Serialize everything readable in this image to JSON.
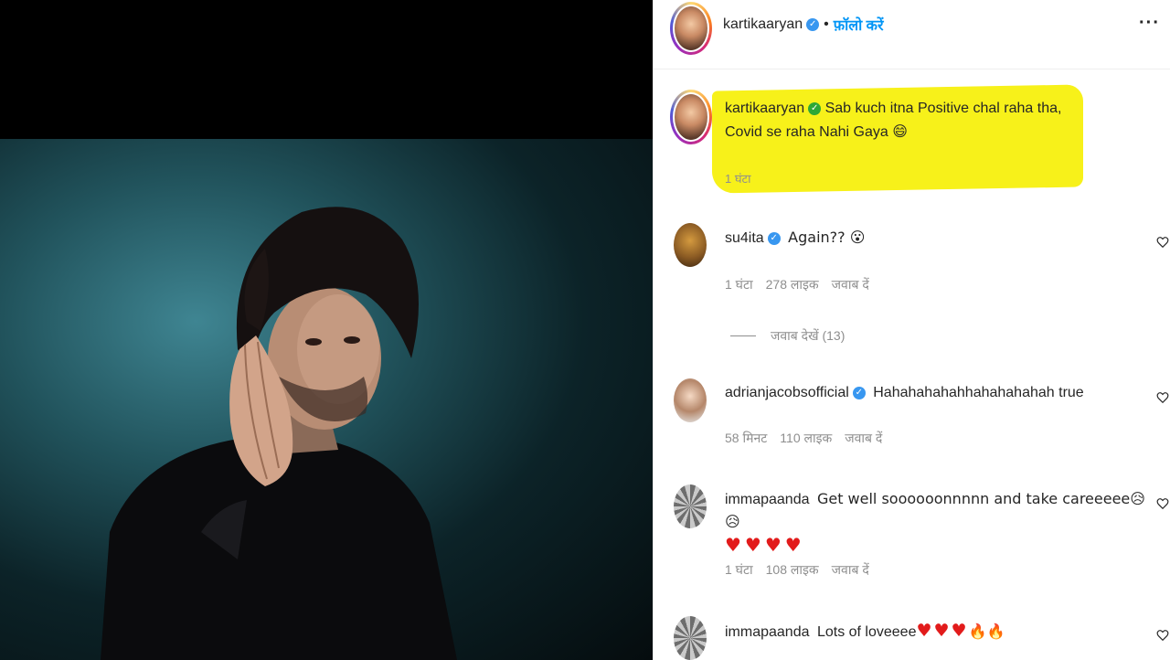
{
  "post": {
    "username": "kartikaaryan",
    "follow_label": "फ़ॉलो करें",
    "more_label": "···",
    "caption_line1": "Sab kuch itna Positive chal raha tha,",
    "caption_line2": "Covid se raha Nahi Gaya 😄",
    "caption_time": "1 घंटा"
  },
  "comments": [
    {
      "username": "su4ita",
      "verified": true,
      "text": "Again?? 😮",
      "time": "1 घंटा",
      "likes": "278 लाइक",
      "reply": "जवाब दें",
      "view_replies": "जवाब देखें (13)"
    },
    {
      "username": "adrianjacobsofficial",
      "verified": true,
      "text": "Hahahahahahhahahahahah true",
      "time": "58 मिनट",
      "likes": "110 लाइक",
      "reply": "जवाब दें"
    },
    {
      "username": "immapaanda",
      "verified": false,
      "text": "Get well soooooonnnnn and take careeeee😥😥",
      "hearts": "♥♥♥♥",
      "time": "1 घंटा",
      "likes": "108 लाइक",
      "reply": "जवाब दें"
    },
    {
      "username": "immapaanda",
      "verified": false,
      "text": "Lots of loveeee",
      "hearts": "♥♥♥",
      "fire": "🔥🔥"
    }
  ],
  "colors": {
    "highlight": "#f7f11a",
    "link": "#0095f6",
    "verified": "#3897f0",
    "meta": "#8e8e8e"
  },
  "icons": [
    "verified-badge-icon",
    "heart-outline-icon",
    "more-options-icon"
  ]
}
